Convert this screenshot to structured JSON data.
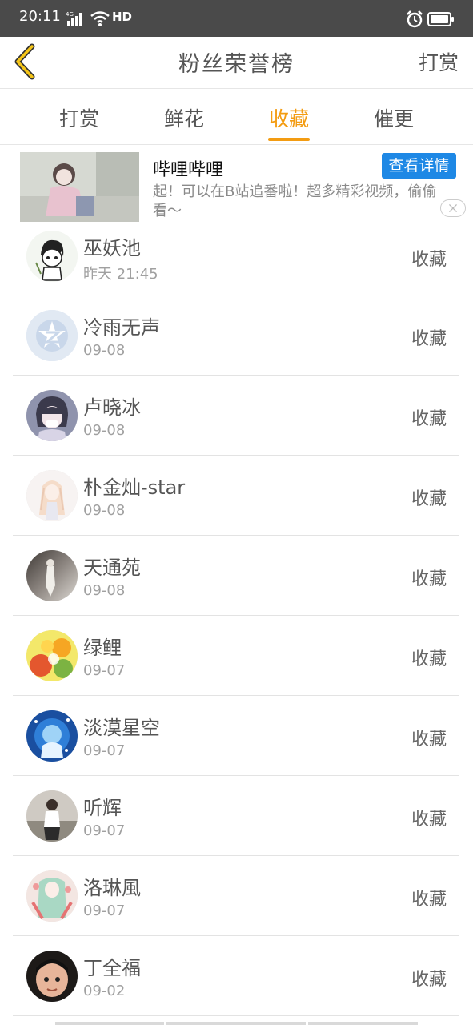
{
  "status_bar": {
    "time": "20:11",
    "network": "4G",
    "hd": "HD",
    "icons": [
      "signal-icon",
      "wifi-icon",
      "alarm-icon",
      "battery-icon"
    ]
  },
  "header": {
    "title": "粉丝荣誉榜",
    "right_button": "打赏",
    "back_icon": "chevron-left-icon",
    "back_color": "#f5c518"
  },
  "tabs": [
    {
      "label": "打赏",
      "active": false
    },
    {
      "label": "鲜花",
      "active": false
    },
    {
      "label": "收藏",
      "active": true
    },
    {
      "label": "催更",
      "active": false
    }
  ],
  "accent_color": "#f39c12",
  "ad": {
    "title": "哔哩哔哩",
    "button": "查看详情",
    "description": "起！可以在B站追番啦！超多精彩视频，偷偷看〜",
    "button_color": "#1e88e5"
  },
  "fans": [
    {
      "name": "巫妖池",
      "date": "昨天 21:45",
      "action": "收藏"
    },
    {
      "name": "冷雨无声",
      "date": "09-08",
      "action": "收藏"
    },
    {
      "name": "卢晓冰",
      "date": "09-08",
      "action": "收藏"
    },
    {
      "name": "朴金灿-star",
      "date": "09-08",
      "action": "收藏"
    },
    {
      "name": "天通苑",
      "date": "09-08",
      "action": "收藏"
    },
    {
      "name": "绿鲤",
      "date": "09-07",
      "action": "收藏"
    },
    {
      "name": "淡漠星空",
      "date": "09-07",
      "action": "收藏"
    },
    {
      "name": "听辉",
      "date": "09-07",
      "action": "收藏"
    },
    {
      "name": "洛琳風",
      "date": "09-07",
      "action": "收藏"
    },
    {
      "name": "丁全福",
      "date": "09-02",
      "action": "收藏"
    }
  ]
}
